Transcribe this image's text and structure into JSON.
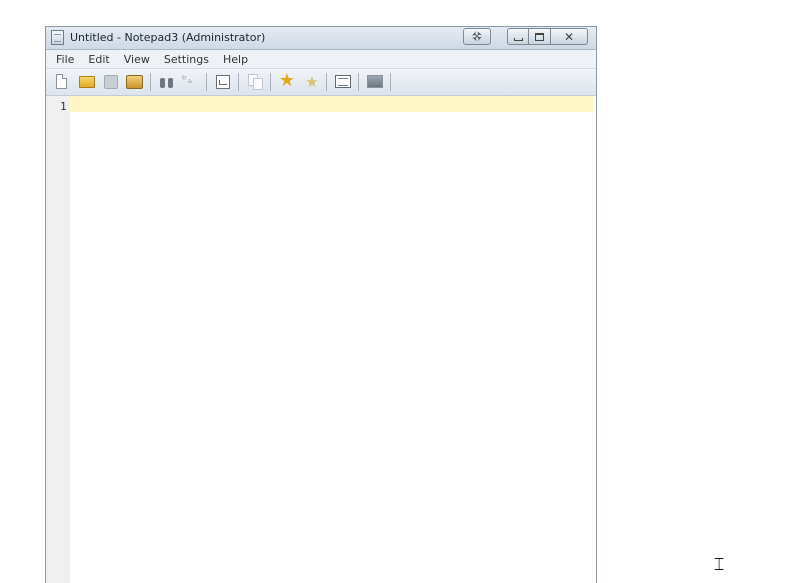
{
  "window": {
    "title": "Untitled - Notepad3 (Administrator)",
    "caption_buttons": {
      "pin": "pin-icon",
      "minimize": "minimize-icon",
      "maximize": "maximize-icon",
      "close": "close-icon"
    }
  },
  "menubar": {
    "items": [
      "File",
      "Edit",
      "View",
      "Settings",
      "Help"
    ]
  },
  "toolbar": {
    "buttons": [
      "new-file-icon",
      "open-folder-icon",
      "save-icon",
      "save-as-icon",
      "find-icon",
      "replace-icon",
      "word-wrap-icon",
      "copy-icon",
      "favorites-icon",
      "add-favorite-icon",
      "list-icon",
      "screen-icon"
    ]
  },
  "editor": {
    "lines": [
      ""
    ],
    "line_numbers": [
      "1"
    ],
    "current_line_color": "#fff8c6"
  },
  "colors": {
    "titlebar": "#d6dfe8",
    "gutter": "#f0f0f0",
    "accent": "#e0a81c"
  }
}
